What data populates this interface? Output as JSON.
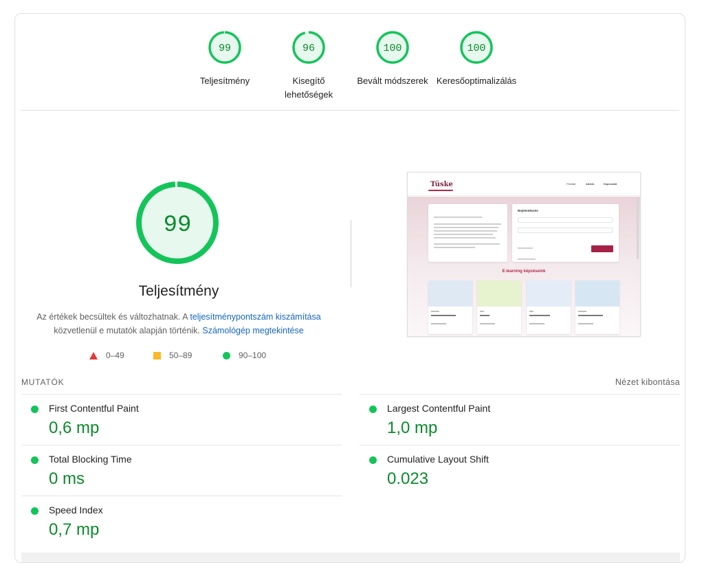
{
  "categories": [
    {
      "score": "99",
      "label": "Teljesítmény",
      "fraction": 0.99
    },
    {
      "score": "96",
      "label": "Kisegítő lehetőségek",
      "fraction": 0.96
    },
    {
      "score": "100",
      "label": "Bevált módszerek",
      "fraction": 1.0
    },
    {
      "score": "100",
      "label": "Keresőoptimalizálás",
      "fraction": 1.0
    }
  ],
  "performance": {
    "score": "99",
    "fraction": 0.99,
    "title": "Teljesítmény",
    "desc_part1": "Az értékek becsültek és változhatnak. A ",
    "desc_link1": "teljesítménypontszám kiszámítása",
    "desc_part2": "közvetlenül e mutatók alapján történik. ",
    "desc_link2": "Számológép megtekintése"
  },
  "legend": {
    "fail": "0–49",
    "average": "50–89",
    "pass": "90–100"
  },
  "thumbnail": {
    "logo": "Tüske",
    "nav": [
      "Főoldal",
      "Admin",
      "Kapcsolat"
    ],
    "login_title": "Bejelentkezés",
    "section_title": "E-learning képzéseink",
    "courses": [
      "Adobe Illustrator",
      "Excel",
      "Webfejlesztés",
      "Adobe Photoshop"
    ]
  },
  "metrics": {
    "title": "MUTATÓK",
    "expand_label": "Nézet kibontása",
    "items": [
      {
        "name": "First Contentful Paint",
        "value": "0,6 mp"
      },
      {
        "name": "Largest Contentful Paint",
        "value": "1,0 mp"
      },
      {
        "name": "Total Blocking Time",
        "value": "0 ms"
      },
      {
        "name": "Cumulative Layout Shift",
        "value": "0.023"
      },
      {
        "name": "Speed Index",
        "value": "0,7 mp"
      }
    ]
  },
  "colors": {
    "pass": "#14c45a",
    "pass_fill": "#e7f8ee",
    "pass_text": "#0c8a2c",
    "average": "#fbb829",
    "fail": "#e53935",
    "link": "#1565c0"
  }
}
